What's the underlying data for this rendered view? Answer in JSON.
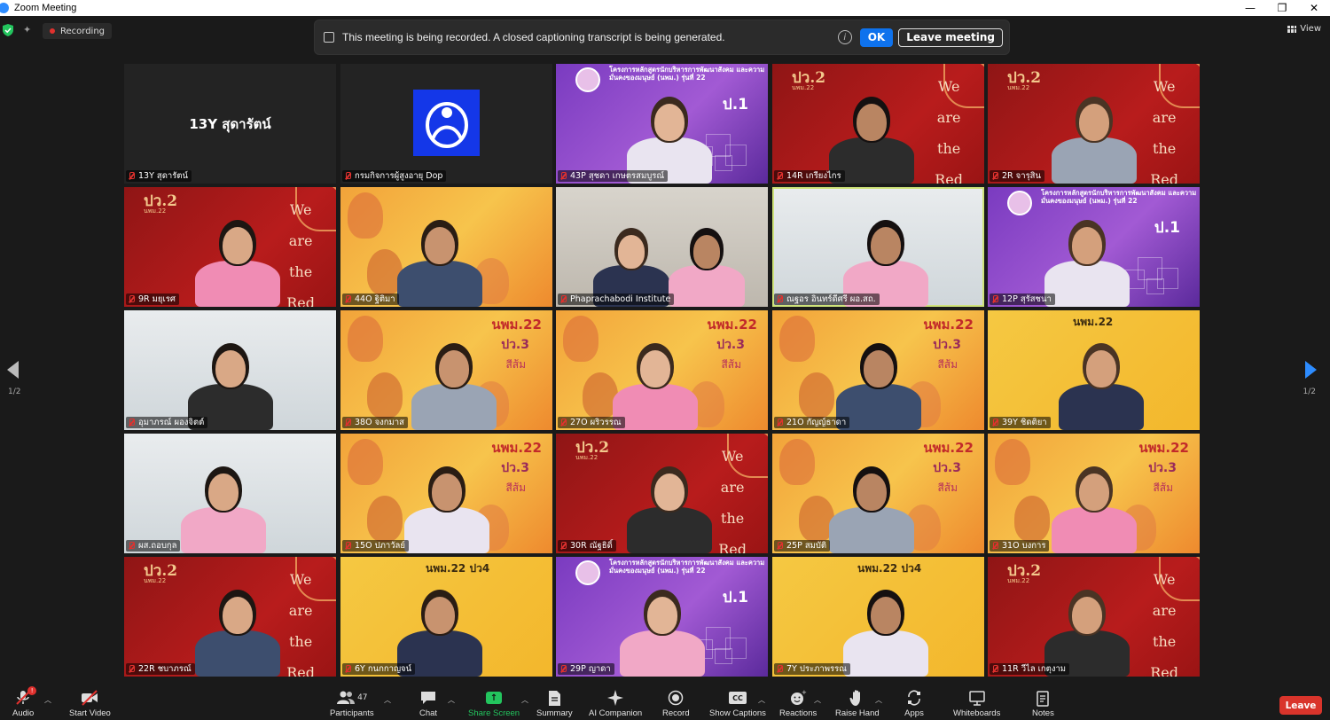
{
  "window": {
    "title": "Zoom Meeting",
    "controls": {
      "minimize": "—",
      "restore": "❐",
      "close": "✕"
    }
  },
  "topbar": {
    "recording_label": "Recording",
    "view_label": "View"
  },
  "banner": {
    "message": "This meeting is being recorded. A closed captioning transcript is being generated.",
    "info_glyph": "i",
    "ok_label": "OK",
    "leave_label": "Leave meeting"
  },
  "pagination": {
    "left": "1/2",
    "right": "1/2"
  },
  "tiles": [
    {
      "name": "13Y สุดารัตน์",
      "bg": "dark",
      "center_text": "13Y สุดารัตน์"
    },
    {
      "name": "กรมกิจการผู้สูงอายุ Dop",
      "bg": "dark",
      "logo": true
    },
    {
      "name": "43P สุชดา เกษตรสมบูรณ์",
      "bg": "purple",
      "code": "ป.1",
      "header": "โครงการหลักสูตรนักบริหารการพัฒนาสังคม และความมั่นคงของมนุษย์ (นพม.) รุ่นที่ 22"
    },
    {
      "name": "14R เกรียงไกร",
      "bg": "red",
      "code": "ปว.2",
      "sub": "นพม.22",
      "words": [
        "We",
        "are",
        "the",
        "Red"
      ]
    },
    {
      "name": "2R จารุสิน",
      "bg": "red",
      "code": "ปว.2",
      "sub": "นพม.22",
      "words": [
        "We",
        "are",
        "the",
        "Red"
      ]
    },
    {
      "name": "9R มยุเรศ",
      "bg": "red",
      "code": "ปว.2",
      "sub": "นพม.22",
      "words": [
        "We",
        "are",
        "the",
        "Red"
      ]
    },
    {
      "name": "44O ฐิติมา",
      "bg": "orange"
    },
    {
      "name": "Phaprachabodi Institute",
      "bg": "office"
    },
    {
      "name": "ณฐอร อินทร์ดีศรี ผอ.สถ.",
      "bg": "light",
      "active": true
    },
    {
      "name": "12P สุรัสชนา",
      "bg": "purple",
      "code": "ป.1",
      "header": "โครงการหลักสูตรนักบริหารการพัฒนาสังคม และความมั่นคงของมนุษย์ (นพม.) รุ่นที่ 22"
    },
    {
      "name": "อุมาภรณ์ ผองจิตต์",
      "bg": "light"
    },
    {
      "name": "38O จงกมาส",
      "bg": "orange",
      "code": "นพม.22",
      "sub": "ปว.3",
      "sub2": "สีส้ม"
    },
    {
      "name": "27O ผริวรรณ",
      "bg": "orange",
      "code": "นพม.22",
      "sub": "ปว.3",
      "sub2": "สีส้ม"
    },
    {
      "name": "21O กัญญ์ธาดา",
      "bg": "orange",
      "code": "นพม.22",
      "sub": "ปว.3",
      "sub2": "สีส้ม"
    },
    {
      "name": "39Y ชิดติยา",
      "bg": "yellow",
      "code": "นพม.22"
    },
    {
      "name": "ผส.ถอบกุล",
      "bg": "light"
    },
    {
      "name": "15O ปภาวัลย์",
      "bg": "orange",
      "code": "นพม.22",
      "sub": "ปว.3",
      "sub2": "สีส้ม"
    },
    {
      "name": "30R ณัฐธิดิ์",
      "bg": "red",
      "code": "ปว.2",
      "sub": "นพม.22",
      "words": [
        "We",
        "are",
        "the",
        "Red"
      ]
    },
    {
      "name": "25P สมบัติ",
      "bg": "orange",
      "code": "นพม.22",
      "sub": "ปว.3",
      "sub2": "สีส้ม"
    },
    {
      "name": "31O บงการ",
      "bg": "orange",
      "code": "นพม.22",
      "sub": "ปว.3",
      "sub2": "สีส้ม"
    },
    {
      "name": "22R ชบาภรณ์",
      "bg": "red",
      "code": "ปว.2",
      "sub": "นพม.22",
      "words": [
        "We",
        "are",
        "the",
        "Red"
      ]
    },
    {
      "name": "6Y กนกกาญจน์",
      "bg": "yellow",
      "code": "นพม.22 ปว4"
    },
    {
      "name": "29P ญาดา",
      "bg": "purple",
      "code": "ป.1",
      "header": "โครงการหลักสูตรนักบริหารการพัฒนาสังคม และความมั่นคงของมนุษย์ (นพม.) รุ่นที่ 22"
    },
    {
      "name": "7Y ประภาพรรณ",
      "bg": "yellow",
      "code": "นพม.22 ปว4"
    },
    {
      "name": "11R วีไล เกตุงาม",
      "bg": "red",
      "code": "ปว.2",
      "sub": "นพม.22",
      "words": [
        "We",
        "are",
        "the",
        "Red"
      ]
    }
  ],
  "toolbar": {
    "audio": "Audio",
    "audio_badge": "!",
    "start_video": "Start Video",
    "participants": "Participants",
    "participants_count": "47",
    "chat": "Chat",
    "share_screen": "Share Screen",
    "summary": "Summary",
    "ai_companion": "AI Companion",
    "record": "Record",
    "show_captions": "Show Captions",
    "captions_glyph": "CC",
    "reactions": "Reactions",
    "raise_hand": "Raise Hand",
    "apps": "Apps",
    "whiteboards": "Whiteboards",
    "notes": "Notes",
    "leave": "Leave"
  },
  "colors": {
    "accent_blue": "#0e72ed",
    "leave_red": "#d9342b",
    "share_green": "#23c55e",
    "active_speaker": "#cfe37a"
  }
}
